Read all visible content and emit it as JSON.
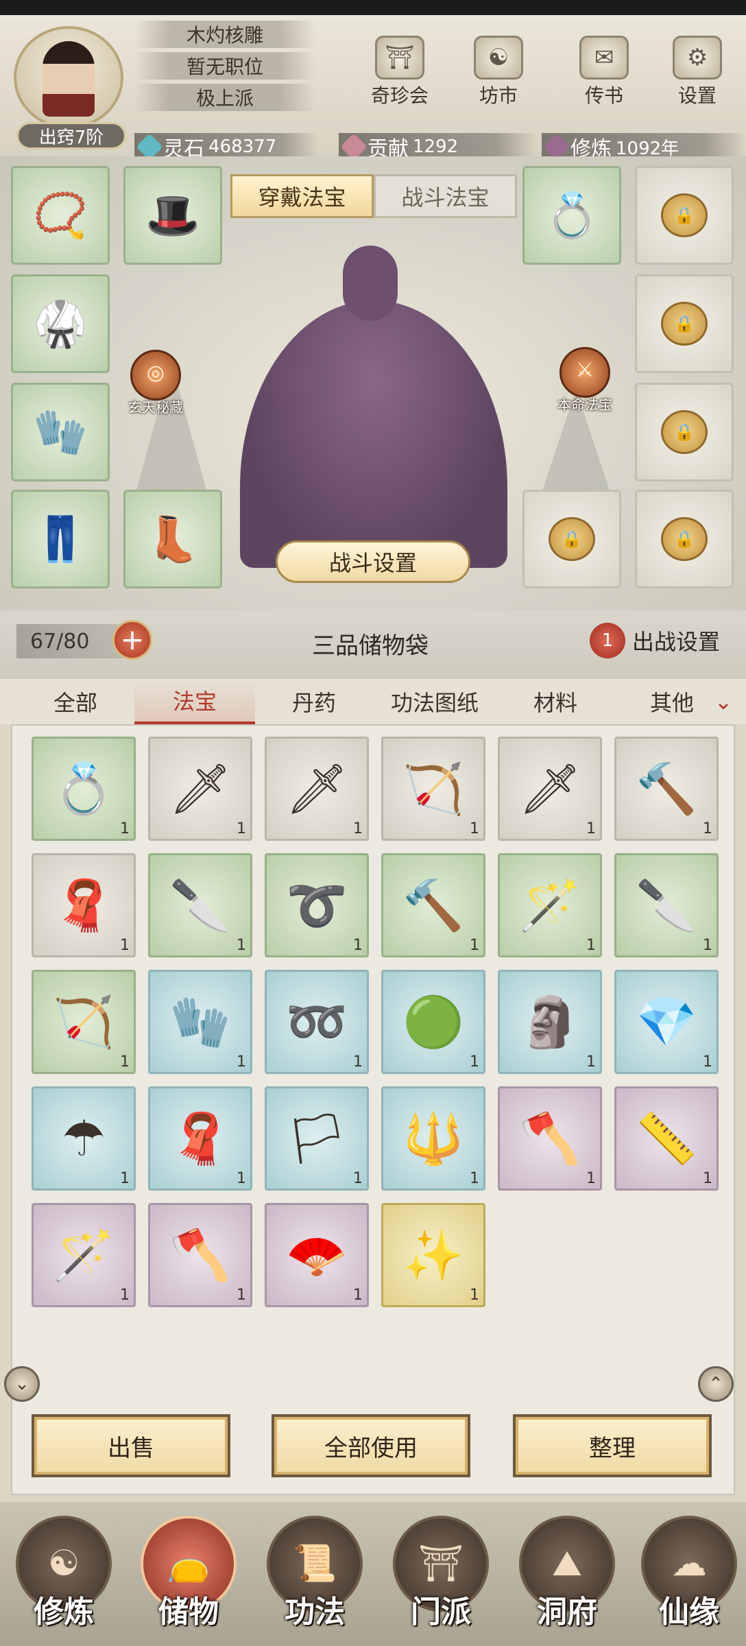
{
  "header": {
    "player_name": "木灼核雕",
    "position": "暂无职位",
    "sect": "极上派",
    "rank": "出窍7阶",
    "buttons": [
      {
        "label": "奇珍会",
        "icon": "treasure-pavilion-icon"
      },
      {
        "label": "坊市",
        "icon": "market-icon"
      },
      {
        "label": "传书",
        "icon": "scroll-letter-icon"
      },
      {
        "label": "设置",
        "icon": "gear-icon"
      }
    ],
    "resources": [
      {
        "key": "灵石",
        "value": "468377",
        "icon": "spirit-stone-icon",
        "color": "#5fb8c2"
      },
      {
        "key": "贡献",
        "value": "1292",
        "icon": "contribution-icon",
        "color": "#c98a95"
      },
      {
        "key": "修炼",
        "value": "1092年",
        "icon": "cultivation-icon",
        "color": "#9a6b8e"
      }
    ]
  },
  "equipment": {
    "tabs": [
      {
        "label": "穿戴法宝",
        "active": true
      },
      {
        "label": "战斗法宝",
        "active": false
      }
    ],
    "left_orb": "玄天秘藏",
    "right_orb": "本命法宝",
    "battle_settings": "战斗设置"
  },
  "bag": {
    "capacity": "67/80",
    "title": "三品储物袋",
    "deploy_count": "1",
    "deploy_label": "出战设置"
  },
  "categories": [
    "全部",
    "法宝",
    "丹药",
    "功法图纸",
    "材料",
    "其他"
  ],
  "active_category": "法宝",
  "items": [
    {
      "icon": "ring-icon",
      "count": "1",
      "quality": "green"
    },
    {
      "icon": "sword-icon",
      "count": "1",
      "quality": "white"
    },
    {
      "icon": "jade-sword-icon",
      "count": "1",
      "quality": "white"
    },
    {
      "icon": "bow-icon",
      "count": "1",
      "quality": "white"
    },
    {
      "icon": "red-sword-icon",
      "count": "1",
      "quality": "white"
    },
    {
      "icon": "hammer-icon",
      "count": "1",
      "quality": "white"
    },
    {
      "icon": "talisman-cloth-icon",
      "count": "1",
      "quality": "white"
    },
    {
      "icon": "saber-icon",
      "count": "1",
      "quality": "green"
    },
    {
      "icon": "whip-icon",
      "count": "1",
      "quality": "green"
    },
    {
      "icon": "blue-hammer-icon",
      "count": "1",
      "quality": "green"
    },
    {
      "icon": "ruyi-scepter-icon",
      "count": "1",
      "quality": "green"
    },
    {
      "icon": "dao-blade-icon",
      "count": "1",
      "quality": "green"
    },
    {
      "icon": "purple-bow-icon",
      "count": "1",
      "quality": "green"
    },
    {
      "icon": "gauntlet-icon",
      "count": "1",
      "quality": "blue"
    },
    {
      "icon": "rope-icon",
      "count": "1",
      "quality": "blue"
    },
    {
      "icon": "mirror-icon",
      "count": "1",
      "quality": "blue"
    },
    {
      "icon": "jade-seal-icon",
      "count": "1",
      "quality": "blue"
    },
    {
      "icon": "ice-seal-icon",
      "count": "1",
      "quality": "blue"
    },
    {
      "icon": "umbrella-icon",
      "count": "1",
      "quality": "blue"
    },
    {
      "icon": "red-cloth-icon",
      "count": "1",
      "quality": "blue"
    },
    {
      "icon": "banner-icon",
      "count": "1",
      "quality": "blue"
    },
    {
      "icon": "spear-icon",
      "count": "1",
      "quality": "blue"
    },
    {
      "icon": "curved-blade-icon",
      "count": "1",
      "quality": "purple"
    },
    {
      "icon": "jade-ruler-icon",
      "count": "1",
      "quality": "purple"
    },
    {
      "icon": "staff-icon",
      "count": "1",
      "quality": "purple"
    },
    {
      "icon": "axe-icon",
      "count": "1",
      "quality": "purple"
    },
    {
      "icon": "fan-icon",
      "count": "1",
      "quality": "purple"
    },
    {
      "icon": "golden-wand-icon",
      "count": "1",
      "quality": "gold"
    }
  ],
  "actions": [
    "出售",
    "全部使用",
    "整理"
  ],
  "nav": [
    {
      "label": "修炼",
      "icon": "cultivation-nav-icon",
      "active": false
    },
    {
      "label": "储物",
      "icon": "storage-bag-icon",
      "active": true
    },
    {
      "label": "功法",
      "icon": "technique-scroll-icon",
      "active": false
    },
    {
      "label": "门派",
      "icon": "sect-gate-icon",
      "active": false
    },
    {
      "label": "洞府",
      "icon": "cave-abode-icon",
      "active": false
    },
    {
      "label": "仙缘",
      "icon": "immortal-fate-icon",
      "active": false
    }
  ]
}
